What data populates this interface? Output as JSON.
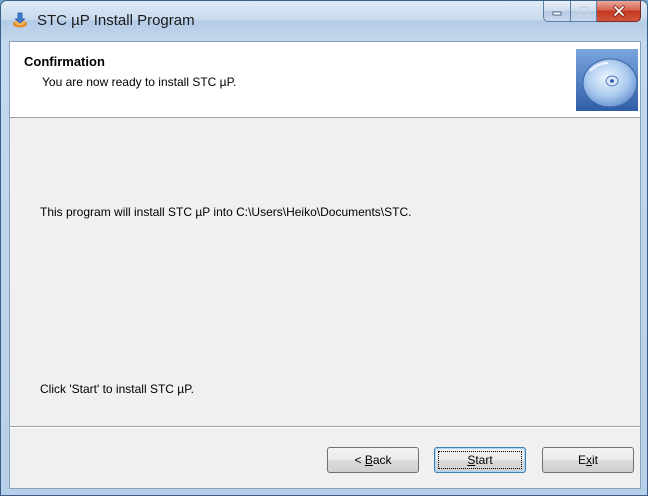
{
  "window": {
    "title": "STC µP Install Program",
    "icons": {
      "app": "installer-icon",
      "minimize": "minimize-icon",
      "maximize": "maximize-icon",
      "close": "close-icon"
    }
  },
  "header": {
    "title": "Confirmation",
    "subtitle": "You are now ready to install STC µP.",
    "image_icon": "cd-disc-icon"
  },
  "body": {
    "install_text": "This program will install STC µP into C:\\Users\\Heiko\\Documents\\STC.",
    "instruction_text": "Click 'Start' to install STC µP."
  },
  "buttons": {
    "back": {
      "prefix": "< ",
      "mnemonic": "B",
      "rest": "ack"
    },
    "start": {
      "prefix": "",
      "mnemonic": "S",
      "rest": "tart"
    },
    "exit": {
      "prefix": "E",
      "mnemonic": "x",
      "rest": "it"
    }
  },
  "colors": {
    "accent": "#3c7fb1",
    "close_button": "#c2371f",
    "title_bar": "#c9dbee"
  }
}
